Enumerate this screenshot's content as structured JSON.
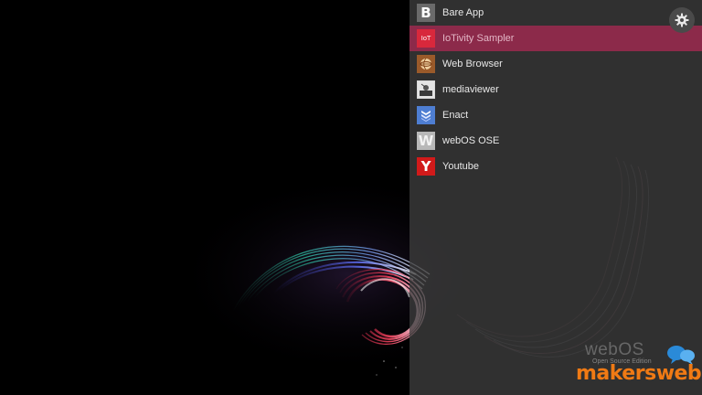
{
  "launcher": {
    "apps": [
      {
        "label": "Bare App",
        "icon": "bare-app-icon",
        "glyph": "B",
        "selected": false
      },
      {
        "label": "IoTivity Sampler",
        "icon": "iotivity-icon",
        "glyph": "IoT",
        "selected": true
      },
      {
        "label": "Web Browser",
        "icon": "web-browser-icon",
        "glyph": "",
        "selected": false
      },
      {
        "label": "mediaviewer",
        "icon": "mediaviewer-icon",
        "glyph": "",
        "selected": false
      },
      {
        "label": "Enact",
        "icon": "enact-icon",
        "glyph": "",
        "selected": false
      },
      {
        "label": "webOS OSE",
        "icon": "webos-ose-icon",
        "glyph": "W",
        "selected": false
      },
      {
        "label": "Youtube",
        "icon": "youtube-icon",
        "glyph": "Y",
        "selected": false
      }
    ],
    "settings_icon": "gear-icon"
  },
  "branding": {
    "webos": "webOS",
    "edition": "Open Source Edition"
  },
  "watermark": {
    "part1": "makers",
    "part2": "web"
  },
  "colors": {
    "selected_row": "#8c2a4a",
    "panel": "#3e3e3e",
    "watermark": "#f07a14"
  }
}
